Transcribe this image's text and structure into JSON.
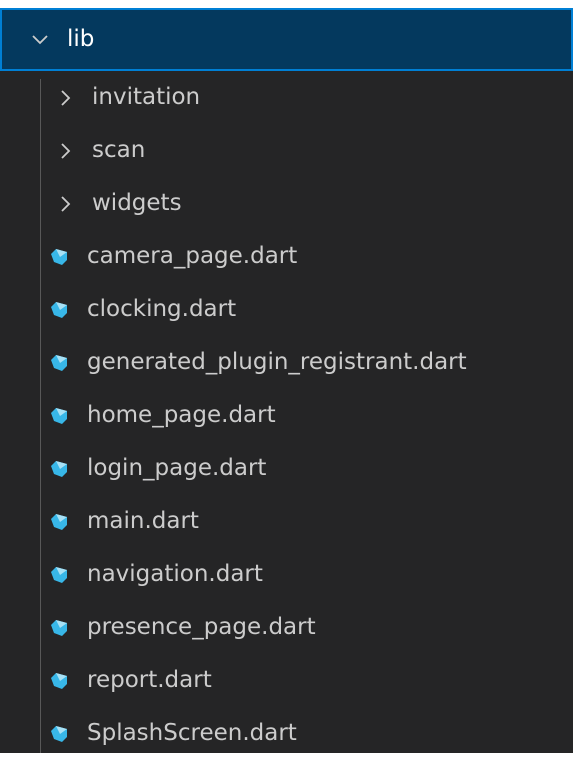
{
  "explorer": {
    "root": {
      "label": "lib",
      "expanded": true
    },
    "folders": [
      {
        "label": "invitation"
      },
      {
        "label": "scan"
      },
      {
        "label": "widgets"
      }
    ],
    "files": [
      {
        "label": "camera_page.dart",
        "icon": "dart-file-icon"
      },
      {
        "label": "clocking.dart",
        "icon": "dart-file-icon"
      },
      {
        "label": "generated_plugin_registrant.dart",
        "icon": "dart-file-icon"
      },
      {
        "label": "home_page.dart",
        "icon": "dart-file-icon"
      },
      {
        "label": "login_page.dart",
        "icon": "dart-file-icon"
      },
      {
        "label": "main.dart",
        "icon": "dart-file-icon"
      },
      {
        "label": "navigation.dart",
        "icon": "dart-file-icon"
      },
      {
        "label": "presence_page.dart",
        "icon": "dart-file-icon"
      },
      {
        "label": "report.dart",
        "icon": "dart-file-icon"
      },
      {
        "label": "SplashScreen.dart",
        "icon": "dart-file-icon"
      }
    ]
  },
  "colors": {
    "panel_bg": "#252526",
    "selection_bg": "#04395e",
    "focus_border": "#007fd4",
    "text": "#cccccc",
    "dart_icon": "#38b7e8"
  }
}
